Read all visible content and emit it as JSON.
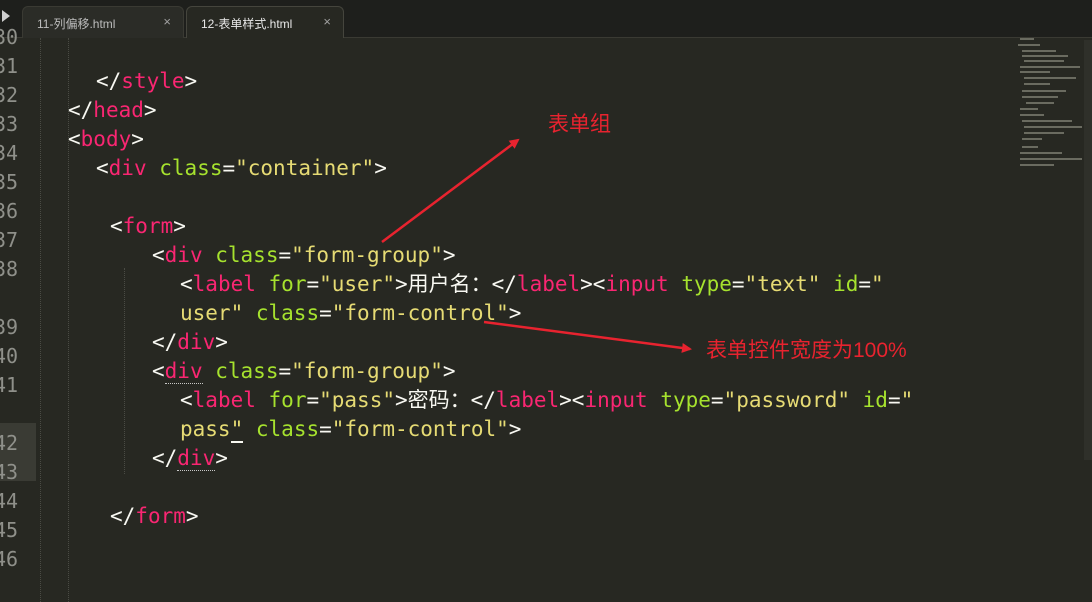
{
  "tabs": [
    {
      "label": "11-列偏移.html",
      "active": false
    },
    {
      "label": "12-表单样式.html",
      "active": true
    }
  ],
  "close_glyph": "×",
  "line_numbers": [
    "30",
    "31",
    "32",
    "33",
    "34",
    "35",
    "36",
    "37",
    "38",
    "39",
    "40",
    "41",
    "42",
    "43",
    "44",
    "45",
    "46"
  ],
  "code": {
    "l31": [
      "</",
      "style",
      ">"
    ],
    "l32": [
      "</",
      "head",
      ">"
    ],
    "l33": [
      "<",
      "body",
      ">"
    ],
    "l34": [
      "<",
      "div",
      " ",
      "class",
      "=",
      "\"container\"",
      ">"
    ],
    "l36": [
      "<",
      "form",
      ">"
    ],
    "l37": [
      "<",
      "div",
      " ",
      "class",
      "=",
      "\"form-group\"",
      ">"
    ],
    "l38a": [
      "<",
      "label",
      " ",
      "for",
      "=",
      "\"user\"",
      ">用户名：</",
      "label",
      "><",
      "input",
      " ",
      "type",
      "=",
      "\"text\"",
      " ",
      "id",
      "=",
      "\""
    ],
    "l38b": [
      "user\"",
      " ",
      "class",
      "=",
      "\"form-control\"",
      ">"
    ],
    "l39": [
      "</",
      "div",
      ">"
    ],
    "l40": [
      "<",
      "div",
      " ",
      "class",
      "=",
      "\"form-group\"",
      ">"
    ],
    "l41a": [
      "<",
      "label",
      " ",
      "for",
      "=",
      "\"pass\"",
      ">密码：</",
      "label",
      "><",
      "input",
      " ",
      "type",
      "=",
      "\"password\"",
      " ",
      "id",
      "=",
      "\""
    ],
    "l41b": [
      "pass",
      "\"",
      " ",
      "class",
      "=",
      "\"form-control\"",
      ">"
    ],
    "l42": [
      "</",
      "div",
      ">"
    ],
    "l44": [
      "</",
      "form",
      ">"
    ]
  },
  "annotations": {
    "form_group_note": "表单组",
    "form_control_note": "表单控件宽度为100%"
  },
  "colors": {
    "background": "#272822",
    "tag": "#f92672",
    "attribute": "#a6e22e",
    "string": "#e6db74",
    "plain": "#f8f8f2",
    "line_number": "#8f908a",
    "annotation": "#e8232f"
  },
  "icons": [
    "sidebar-toggle-icon",
    "close-icon"
  ]
}
